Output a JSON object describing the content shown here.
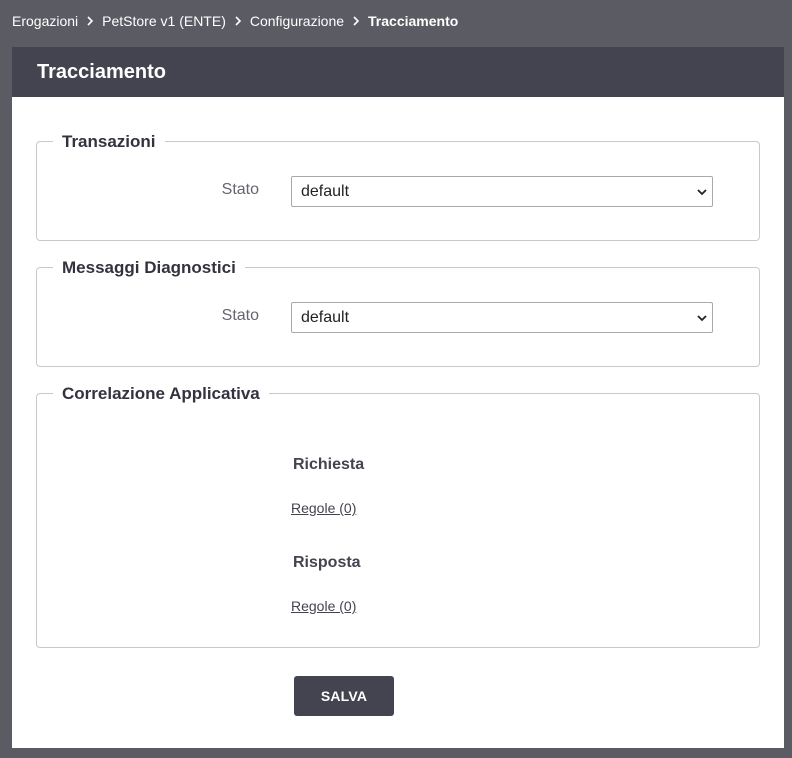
{
  "breadcrumb": {
    "items": [
      "Erogazioni",
      "PetStore v1 (ENTE)",
      "Configurazione"
    ],
    "current": "Tracciamento",
    "separator_icon": "chevron-right-icon"
  },
  "page": {
    "title": "Tracciamento"
  },
  "transazioni": {
    "legend": "Transazioni",
    "stato_label": "Stato",
    "stato_value": "default"
  },
  "diagnostici": {
    "legend": "Messaggi Diagnostici",
    "stato_label": "Stato",
    "stato_value": "default"
  },
  "correlazione": {
    "legend": "Correlazione Applicativa",
    "richiesta": {
      "title": "Richiesta",
      "link": "Regole (0)"
    },
    "risposta": {
      "title": "Risposta",
      "link": "Regole (0)"
    }
  },
  "actions": {
    "save_label": "SALVA"
  },
  "colors": {
    "background": "#5b5b63",
    "header": "#444450",
    "button": "#444450"
  }
}
